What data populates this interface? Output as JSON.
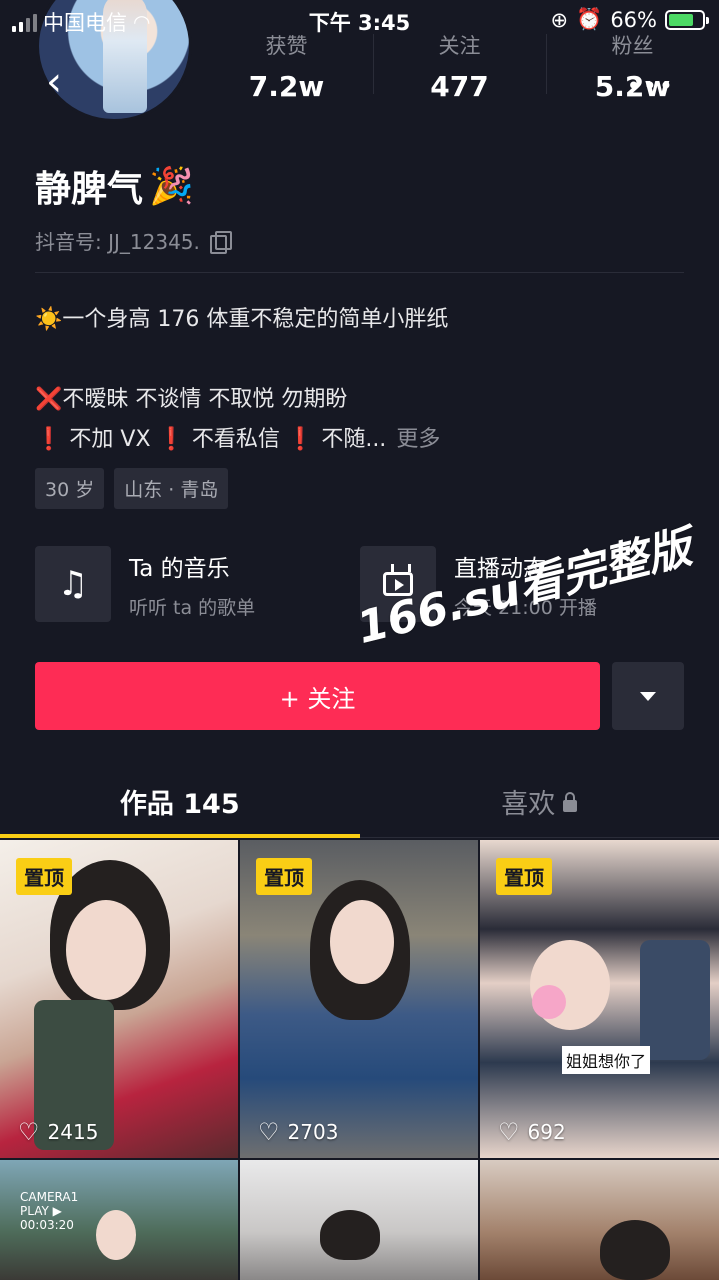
{
  "status_bar": {
    "carrier": "中国电信",
    "time": "下午 3:45",
    "battery": "66%"
  },
  "stats": [
    {
      "label": "获赞",
      "value": "7.2w"
    },
    {
      "label": "关注",
      "value": "477"
    },
    {
      "label": "粉丝",
      "value": "5.2w"
    }
  ],
  "profile": {
    "name": "静脾气",
    "name_emoji": "🎉",
    "douyin_id": "抖音号: JJ_12345."
  },
  "bio": {
    "line1_emoji": "☀️",
    "line1": "一个身高 176 体重不稳定的简单小胖纸",
    "line2_mark": "❌",
    "line2": "不暧昧 不谈情  不取悦 勿期盼",
    "line3_mark": "❗",
    "line3_a": " 不加 VX  ",
    "line3_b": " 不看私信  ",
    "line3_c": " 不随...",
    "more": "更多"
  },
  "tags": [
    "30 岁",
    "山东 · 青岛"
  ],
  "cards": [
    {
      "icon": "music-note-icon",
      "title": "Ta 的音乐",
      "subtitle": "听听 ta 的歌单"
    },
    {
      "icon": "tv-icon",
      "title": "直播动态",
      "subtitle": "今天 21:00 开播"
    }
  ],
  "follow_button": "+ 关注",
  "watermark": "166.su看完整版",
  "tabs": [
    {
      "label": "作品 145",
      "active": true
    },
    {
      "label": "喜欢",
      "active": false,
      "locked": true
    }
  ],
  "videos": [
    {
      "pinned": "置顶",
      "likes": "2415"
    },
    {
      "pinned": "置顶",
      "likes": "2703"
    },
    {
      "pinned": "置顶",
      "likes": "692",
      "sticker_text": "姐姐想你了"
    },
    {
      "overlay_text": "CAMERA1 PLAY ▶ 00:03:20"
    },
    {},
    {}
  ],
  "colors": {
    "background": "#161823",
    "follow": "#fe2c55",
    "pin": "#face15",
    "tab_indicator": "#face15"
  }
}
